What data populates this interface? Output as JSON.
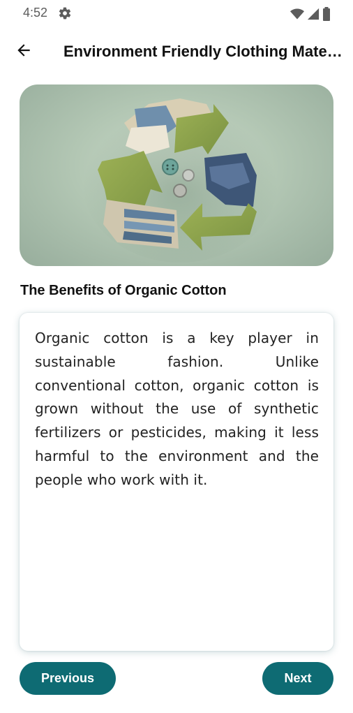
{
  "status_bar": {
    "time": "4:52",
    "icons": [
      "gear-icon",
      "wifi-icon",
      "signal-icon",
      "battery-icon"
    ]
  },
  "app_bar": {
    "title": "Environment Friendly Clothing Materials",
    "back_icon": "arrow-left-icon"
  },
  "hero_image": {
    "alt": "recycle-symbol-of-clothing"
  },
  "section": {
    "title": "The Benefits of Organic Cotton",
    "body": "Organic cotton is a key player in sustainable fashion. Unlike conventional cotton, organic cotton is grown without the use of synthetic fertilizers or pesticides, making it less harmful to the environment and the people who work with it."
  },
  "navigation": {
    "previous_label": "Previous",
    "next_label": "Next"
  },
  "colors": {
    "accent": "#0e6b73",
    "hero_bg": "#b3c7b4",
    "felt_green": "#8fa34c"
  }
}
